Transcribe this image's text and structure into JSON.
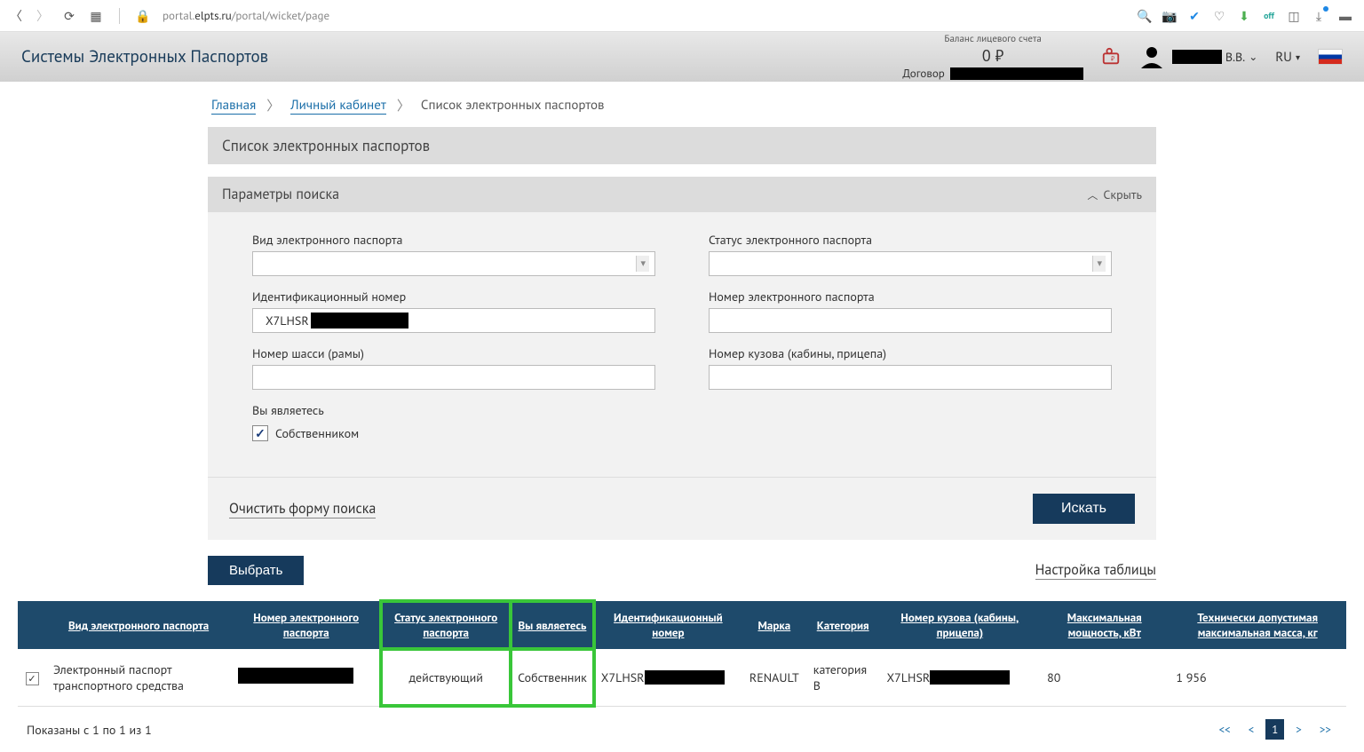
{
  "browser": {
    "url_prefix": "portal.",
    "url_domain": "elpts.ru",
    "url_path": "/portal/wicket/page"
  },
  "header": {
    "site_title": "Системы Электронных Паспортов",
    "balance_label": "Баланс лицевого счета",
    "balance_amount": "0 ₽",
    "contract_label": "Договор",
    "user_initials": "В.В.",
    "lang": "RU"
  },
  "breadcrumb": {
    "home": "Главная",
    "cabinet": "Личный кабинет",
    "current": "Список электронных паспортов"
  },
  "panel": {
    "list_title": "Список электронных паспортов",
    "search_title": "Параметры поиска",
    "collapse": "Скрыть"
  },
  "form": {
    "passport_type_label": "Вид электронного паспорта",
    "status_label": "Статус электронного паспорта",
    "id_number_label": "Идентификационный номер",
    "id_number_value_prefix": "X7LHSR",
    "passport_number_label": "Номер электронного паспорта",
    "chassis_label": "Номер шасси (рамы)",
    "body_label": "Номер кузова (кабины, прицепа)",
    "you_are_label": "Вы являетесь",
    "owner_checkbox": "Собственником",
    "clear": "Очистить форму поиска",
    "search": "Искать"
  },
  "controls": {
    "select": "Выбрать",
    "settings": "Настройка таблицы"
  },
  "table": {
    "headers": {
      "type": "Вид электронного паспорта",
      "number": "Номер электронного паспорта",
      "status": "Статус электронного паспорта",
      "you_are": "Вы являетесь",
      "id": "Идентификационный номер",
      "brand": "Марка",
      "category": "Категория",
      "body": "Номер кузова (кабины, прицепа)",
      "power": "Максимальная мощность, кВт",
      "mass": "Технически допустимая максимальная масса, кг"
    },
    "row": {
      "type": "Электронный паспорт транспортного средства",
      "status": "действующий",
      "you_are": "Собственник",
      "id_prefix": "X7LHSR",
      "brand": "RENAULT",
      "category": "категория B",
      "body_prefix": "X7LHSR",
      "power": "80",
      "mass": "1 956"
    }
  },
  "footer": {
    "shown": "Показаны с 1 по 1 из 1",
    "page": "1"
  }
}
